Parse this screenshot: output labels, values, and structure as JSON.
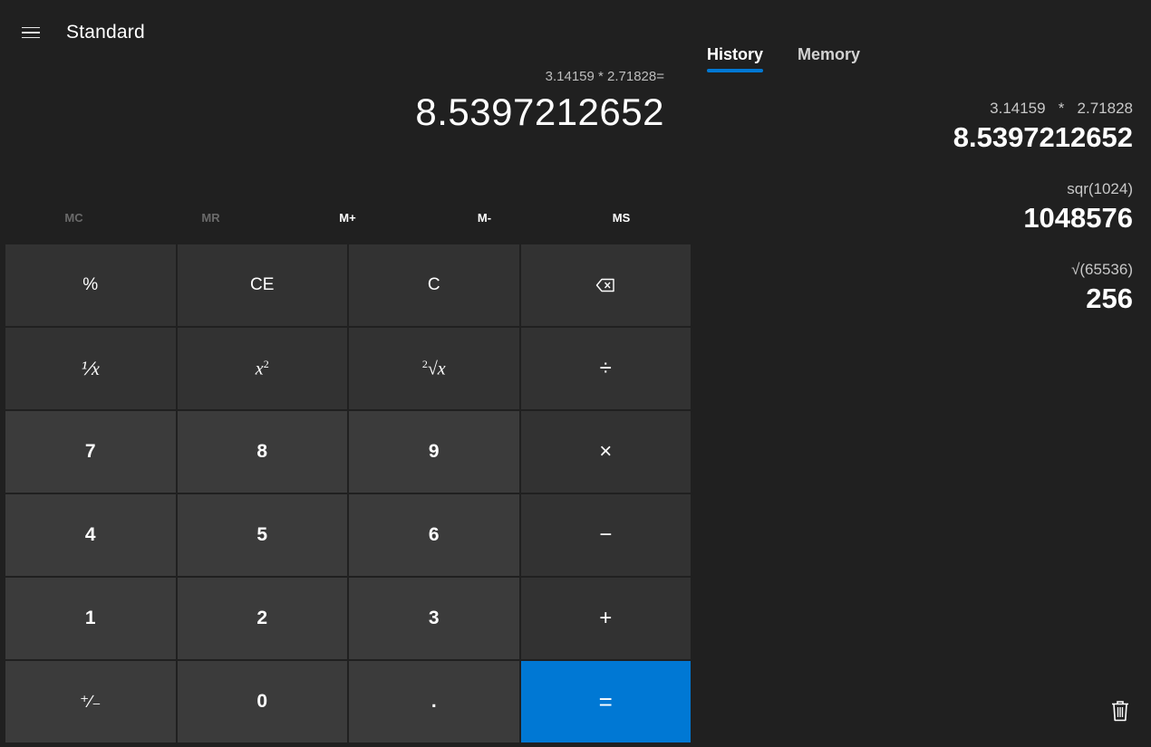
{
  "header": {
    "mode_title": "Standard"
  },
  "display": {
    "expression": "3.14159 * 2.71828=",
    "result": "8.5397212652"
  },
  "memory": {
    "buttons": [
      "MC",
      "MR",
      "M+",
      "M-",
      "MS"
    ]
  },
  "keypad": {
    "percent": "%",
    "clear_entry": "CE",
    "clear": "C",
    "k7": "7",
    "k8": "8",
    "k9": "9",
    "k4": "4",
    "k5": "5",
    "k6": "6",
    "k1": "1",
    "k2": "2",
    "k3": "3",
    "k0": "0",
    "decimal": ".",
    "sign": "⁺∕₋"
  },
  "panel": {
    "tabs": [
      "History",
      "Memory"
    ],
    "active_tab": "History",
    "history": [
      {
        "expression": "3.14159   *   2.71828",
        "result": "8.5397212652"
      },
      {
        "expression": "sqr(1024)",
        "result": "1048576"
      },
      {
        "expression": "√(65536)",
        "result": "256"
      }
    ]
  },
  "colors": {
    "background": "#202020",
    "accent": "#0078d4",
    "key_function": "#323232",
    "key_number": "#3b3b3b"
  }
}
